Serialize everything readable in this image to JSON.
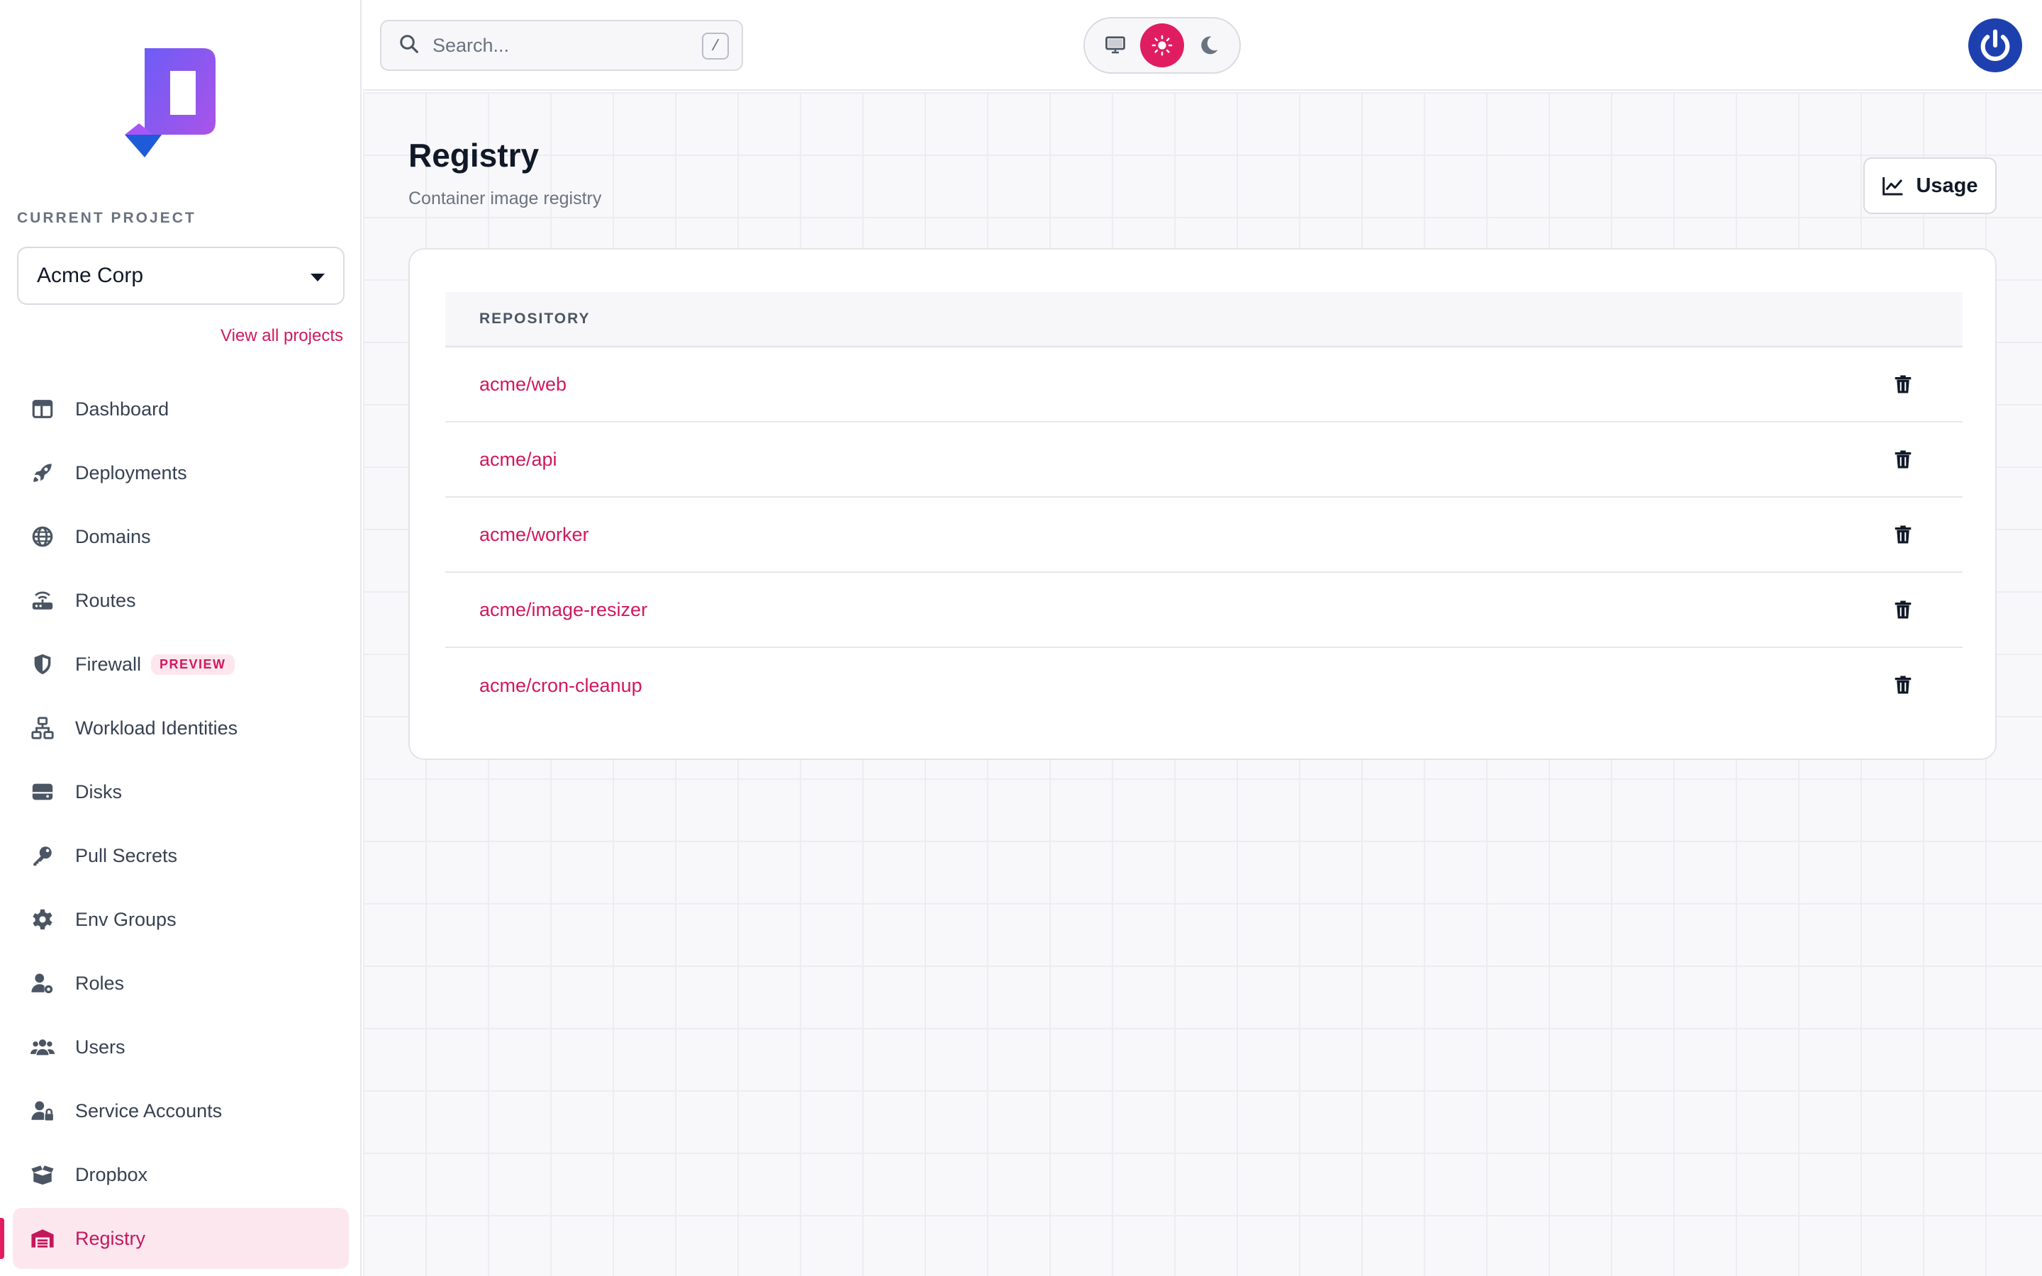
{
  "sidebar": {
    "current_project_label": "CURRENT PROJECT",
    "project_name": "Acme Corp",
    "view_all_label": "View all projects",
    "items": [
      {
        "label": "Dashboard",
        "icon": "dashboard-icon"
      },
      {
        "label": "Deployments",
        "icon": "rocket-icon"
      },
      {
        "label": "Domains",
        "icon": "globe-icon"
      },
      {
        "label": "Routes",
        "icon": "router-icon"
      },
      {
        "label": "Firewall",
        "icon": "shield-icon",
        "badge": "PREVIEW"
      },
      {
        "label": "Workload Identities",
        "icon": "network-icon"
      },
      {
        "label": "Disks",
        "icon": "disk-icon"
      },
      {
        "label": "Pull Secrets",
        "icon": "key-icon"
      },
      {
        "label": "Env Groups",
        "icon": "gear-icon"
      },
      {
        "label": "Roles",
        "icon": "user-gear-icon"
      },
      {
        "label": "Users",
        "icon": "users-icon"
      },
      {
        "label": "Service Accounts",
        "icon": "user-lock-icon"
      },
      {
        "label": "Dropbox",
        "icon": "box-open-icon"
      },
      {
        "label": "Registry",
        "icon": "warehouse-icon",
        "active": true
      }
    ]
  },
  "topbar": {
    "search_placeholder": "Search...",
    "search_shortcut": "/",
    "theme_options": [
      "system",
      "light",
      "dark"
    ],
    "theme_selected": "light"
  },
  "main": {
    "title": "Registry",
    "subtitle": "Container image registry",
    "usage_label": "Usage",
    "table": {
      "header": "REPOSITORY",
      "rows": [
        "acme/web",
        "acme/api",
        "acme/worker",
        "acme/image-resizer",
        "acme/cron-cleanup"
      ]
    }
  },
  "colors": {
    "accent": "#e11d62",
    "link": "#d0185e",
    "active_bg": "#fde7ef",
    "avatar": "#1e40af"
  }
}
